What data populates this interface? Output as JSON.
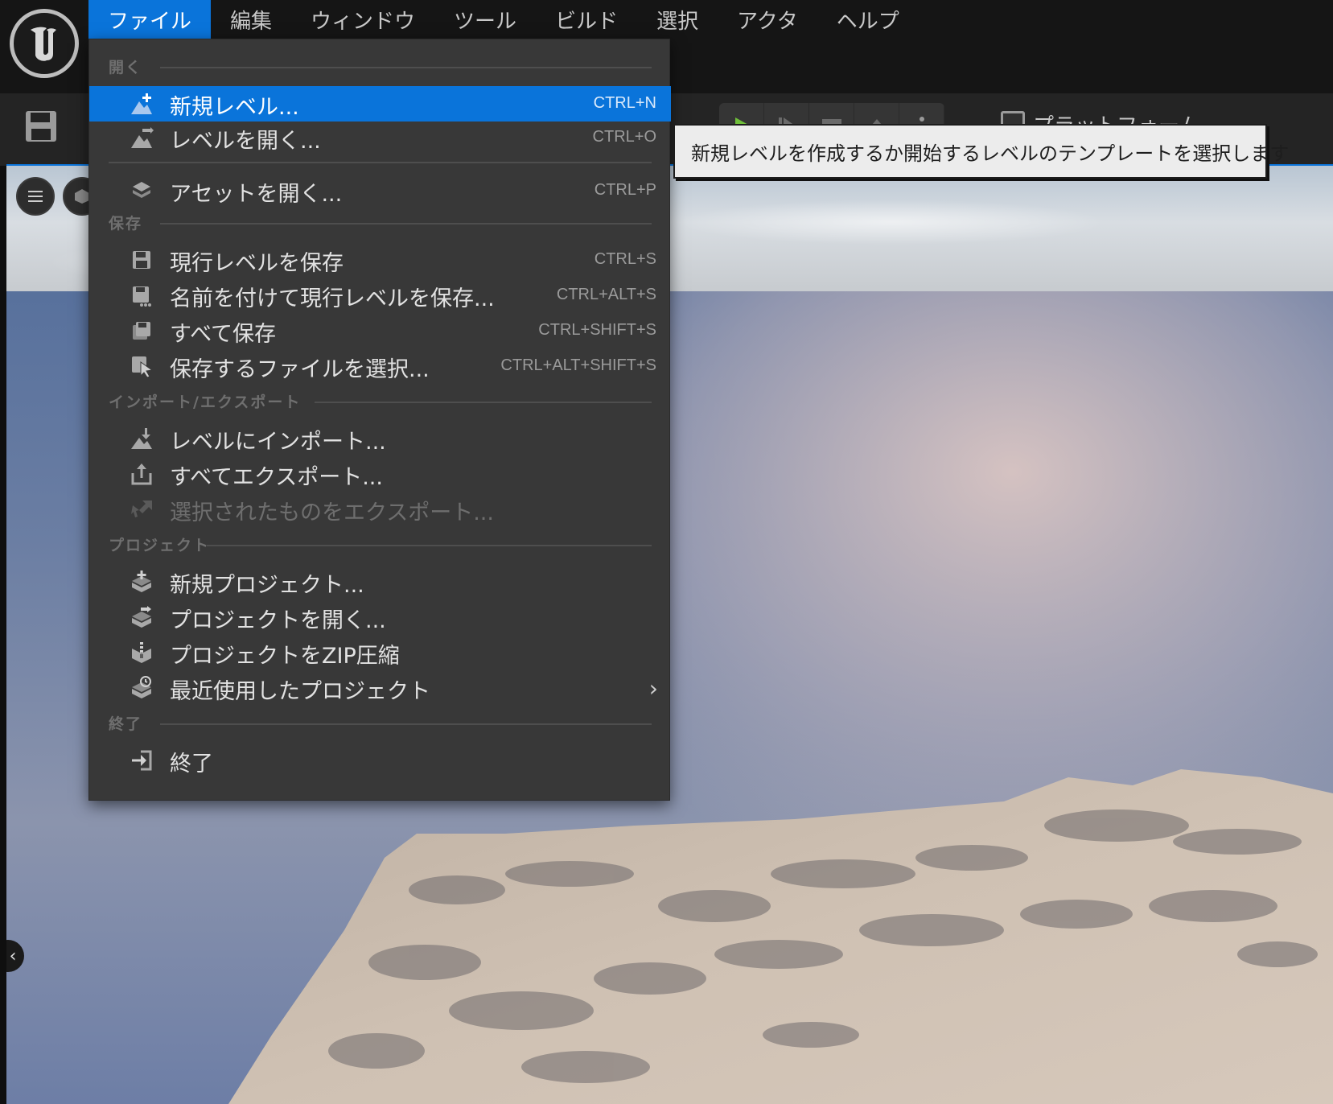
{
  "menubar": {
    "items": [
      {
        "label": "ファイル",
        "active": true
      },
      {
        "label": "編集"
      },
      {
        "label": "ウィンドウ"
      },
      {
        "label": "ツール"
      },
      {
        "label": "ビルド"
      },
      {
        "label": "選択"
      },
      {
        "label": "アクタ"
      },
      {
        "label": "ヘルプ"
      }
    ]
  },
  "toolbar": {
    "platform_label": "プラットフォーム"
  },
  "file_menu": {
    "sections": {
      "open": "開く",
      "save": "保存",
      "import_export": "インポート/エクスポート",
      "project": "プロジェクト",
      "exit": "終了"
    },
    "items": {
      "new_level": {
        "label": "新規レベル...",
        "shortcut": "CTRL+N",
        "icon": "new-level-icon"
      },
      "open_level": {
        "label": "レベルを開く...",
        "shortcut": "CTRL+O",
        "icon": "open-level-icon"
      },
      "open_asset": {
        "label": "アセットを開く...",
        "shortcut": "CTRL+P",
        "icon": "open-asset-icon"
      },
      "save_current": {
        "label": "現行レベルを保存",
        "shortcut": "CTRL+S",
        "icon": "save-icon"
      },
      "save_as": {
        "label": "名前を付けて現行レベルを保存...",
        "shortcut": "CTRL+ALT+S",
        "icon": "save-as-icon"
      },
      "save_all": {
        "label": "すべて保存",
        "shortcut": "CTRL+SHIFT+S",
        "icon": "save-all-icon"
      },
      "choose_files": {
        "label": "保存するファイルを選択...",
        "shortcut": "CTRL+ALT+SHIFT+S",
        "icon": "choose-files-icon"
      },
      "import_level": {
        "label": "レベルにインポート...",
        "icon": "import-icon"
      },
      "export_all": {
        "label": "すべてエクスポート...",
        "icon": "export-icon"
      },
      "export_selected": {
        "label": "選択されたものをエクスポート...",
        "icon": "export-selected-icon",
        "disabled": true
      },
      "new_project": {
        "label": "新規プロジェクト...",
        "icon": "new-project-icon"
      },
      "open_project": {
        "label": "プロジェクトを開く...",
        "icon": "open-project-icon"
      },
      "zip_project": {
        "label": "プロジェクトをZIP圧縮",
        "icon": "zip-project-icon"
      },
      "recent_projects": {
        "label": "最近使用したプロジェクト",
        "icon": "recent-projects-icon",
        "submenu": true
      },
      "exit": {
        "label": "終了",
        "icon": "exit-icon"
      }
    }
  },
  "tooltip": {
    "text": "新規レベルを作成するか開始するレベルのテンプレートを選択します"
  },
  "colors": {
    "accent": "#0a74da",
    "menu_bg": "#383838",
    "menubar_bg": "#151515",
    "play_green": "#6fbf3a"
  }
}
